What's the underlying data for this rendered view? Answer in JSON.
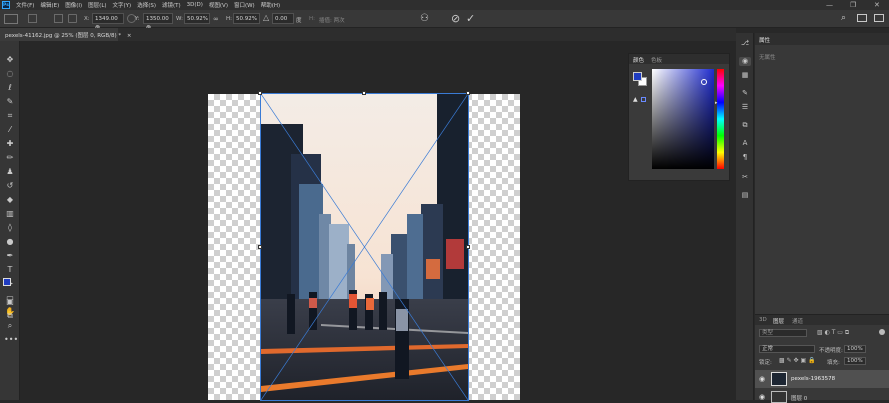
{
  "app": {
    "logo_text": "Ps"
  },
  "menu": {
    "items": [
      "文件(F)",
      "编辑(E)",
      "图像(I)",
      "图层(L)",
      "文字(Y)",
      "选择(S)",
      "滤镜(T)",
      "3D(D)",
      "视图(V)",
      "窗口(W)",
      "帮助(H)"
    ]
  },
  "window_controls": {
    "minimize": "—",
    "maximize": "❐",
    "close": "✕"
  },
  "options": {
    "x_label": "X:",
    "x_value": "1349.00 像",
    "y_label": "Y:",
    "y_value": "1350.00 像",
    "w_label": "W:",
    "w_value": "50.92%",
    "h_label": "H:",
    "h_value": "50.92%",
    "angle_value": "0.00",
    "angle_unit": "度",
    "interp_label": "插值: 两次",
    "commit_cancel": "⊘",
    "commit_ok": "✓"
  },
  "document": {
    "tab_title": "pexels-41162.jpg @ 25% (图层 0, RGB/8) *",
    "close": "×"
  },
  "color_panel": {
    "tabs": [
      "颜色",
      "色板"
    ],
    "foreground": "#1f3cc0",
    "background": "#ffffff",
    "field_hue": "#1f2ccf"
  },
  "properties_panel": {
    "tab": "属性",
    "empty_text": "无属性"
  },
  "layers_panel": {
    "tabs": [
      "3D",
      "图层",
      "通道"
    ],
    "filter_placeholder": "类型",
    "blend_mode": "正常",
    "opacity_label": "不透明度:",
    "opacity_value": "100%",
    "lock_label": "锁定:",
    "fill_label": "填充:",
    "fill_value": "100%",
    "layers": [
      {
        "name": "pexels-1963578",
        "visible": true
      },
      {
        "name": "图层 0",
        "visible": true
      }
    ]
  },
  "colors": {
    "accent": "#31a8ff",
    "panel_bg": "#383838",
    "canvas_bg": "#272727"
  }
}
